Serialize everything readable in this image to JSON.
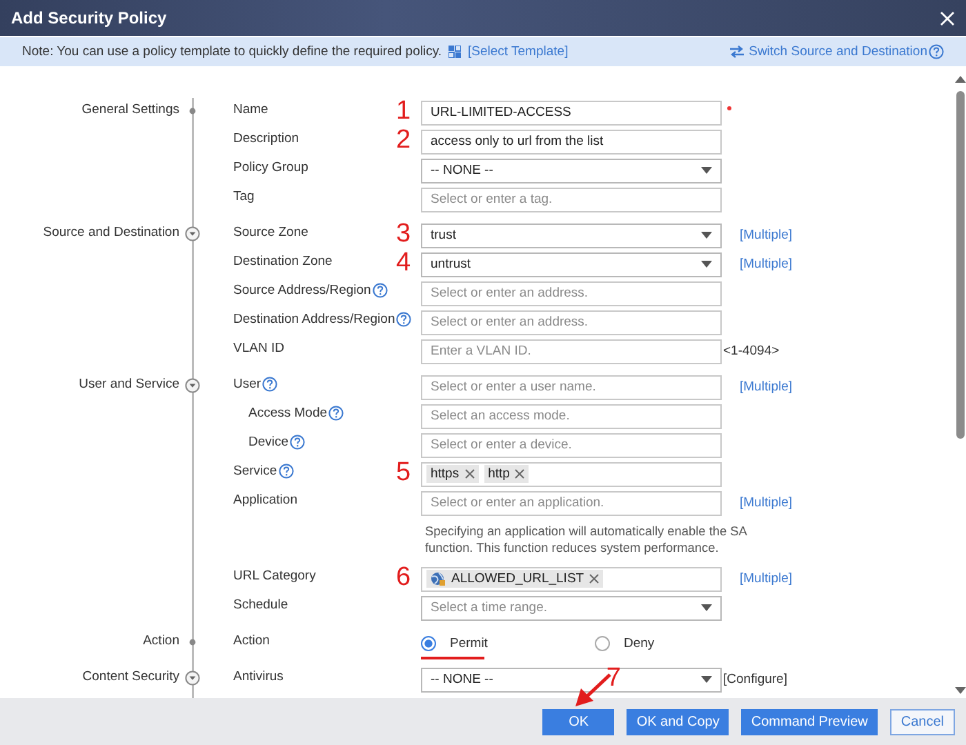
{
  "window": {
    "title": "Add Security Policy"
  },
  "note": {
    "text": "Note: You can use a policy template to quickly define the required policy.",
    "template_link": "[Select Template]",
    "switch_link": "Switch Source and Destination"
  },
  "sections": [
    {
      "label": "General Settings",
      "collapsible": false,
      "rows": [
        {
          "label": "Name",
          "kind": "text",
          "value": "URL-LIMITED-ACCESS",
          "required": true,
          "annotation": "1"
        },
        {
          "label": "Description",
          "kind": "text",
          "value": "access only to url from the list",
          "annotation": "2"
        },
        {
          "label": "Policy Group",
          "kind": "select",
          "value": "-- NONE --"
        },
        {
          "label": "Tag",
          "kind": "text",
          "placeholder": "Select or enter a tag."
        }
      ]
    },
    {
      "label": "Source and Destination",
      "collapsible": true,
      "rows": [
        {
          "label": "Source Zone",
          "kind": "select",
          "value": "trust",
          "annotation": "3",
          "extra": {
            "text": "[Multiple]",
            "kind": "link"
          }
        },
        {
          "label": "Destination Zone",
          "kind": "select",
          "value": "untrust",
          "annotation": "4",
          "extra": {
            "text": "[Multiple]",
            "kind": "link"
          }
        },
        {
          "label": "Source Address/Region",
          "kind": "text",
          "help": true,
          "placeholder": "Select or enter an address."
        },
        {
          "label": "Destination Address/Region",
          "kind": "text",
          "help": true,
          "placeholder": "Select or enter an address."
        },
        {
          "label": "VLAN ID",
          "kind": "text",
          "placeholder": "Enter a VLAN ID.",
          "extra": {
            "text": "<1-4094>",
            "kind": "text"
          }
        }
      ]
    },
    {
      "label": "User and Service",
      "collapsible": true,
      "rows": [
        {
          "label": "User",
          "kind": "text",
          "help": true,
          "placeholder": "Select or enter a user name.",
          "extra": {
            "text": "[Multiple]",
            "kind": "link"
          }
        },
        {
          "label": "Access Mode",
          "kind": "text",
          "help": true,
          "indent": true,
          "placeholder": "Select an access mode."
        },
        {
          "label": "Device",
          "kind": "text",
          "help": true,
          "indent": true,
          "placeholder": "Select or enter a device."
        },
        {
          "label": "Service",
          "kind": "tags",
          "help": true,
          "annotation": "5",
          "tags": [
            {
              "text": "https",
              "kind": "plain"
            },
            {
              "text": "http",
              "kind": "plain"
            }
          ]
        },
        {
          "label": "Application",
          "kind": "text",
          "placeholder": "Select or enter an application.",
          "extra": {
            "text": "[Multiple]",
            "kind": "link"
          }
        },
        {
          "kind": "hint",
          "text": "Specifying an application will automatically enable the SA function. This function reduces system performance."
        },
        {
          "label": "URL Category",
          "kind": "tags",
          "annotation": "6",
          "tags": [
            {
              "text": "ALLOWED_URL_LIST",
              "kind": "category"
            }
          ],
          "extra": {
            "text": "[Multiple]",
            "kind": "link"
          }
        },
        {
          "label": "Schedule",
          "kind": "select",
          "placeholder": "Select a time range."
        }
      ]
    },
    {
      "label": "Action",
      "collapsible": false,
      "rows": [
        {
          "label": "Action",
          "kind": "radio",
          "options": [
            {
              "label": "Permit",
              "selected": true,
              "underlined": true
            },
            {
              "label": "Deny",
              "selected": false,
              "underlined": false
            }
          ]
        }
      ]
    },
    {
      "label": "Content Security",
      "collapsible": true,
      "rows": [
        {
          "label": "Antivirus",
          "kind": "select",
          "value": "-- NONE --",
          "extra": {
            "text": "[Configure]",
            "kind": "text"
          }
        }
      ]
    }
  ],
  "footer": {
    "buttons": [
      {
        "label": "OK",
        "kind": "primary",
        "annotation": "7"
      },
      {
        "label": "OK and Copy",
        "kind": "primary"
      },
      {
        "label": "Command Preview",
        "kind": "primary"
      },
      {
        "label": "Cancel",
        "kind": "secondary"
      }
    ]
  }
}
